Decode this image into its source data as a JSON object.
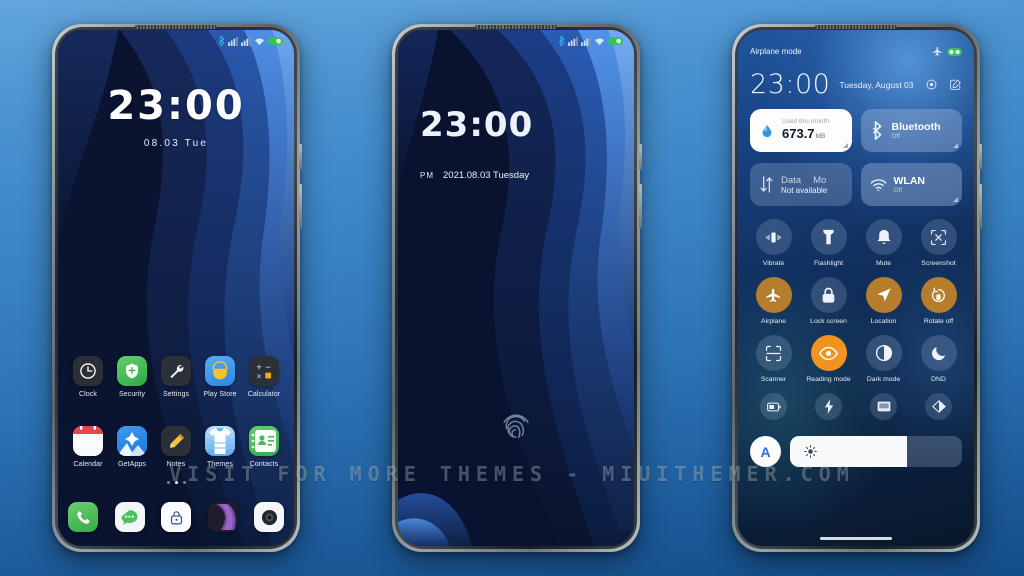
{
  "watermark": "VISIT FOR MORE THEMES - MIUITHEMER.COM",
  "theme": {
    "background_gradient_top": "#63a6dd",
    "background_gradient_bottom": "#144d88",
    "wallpaper_dark": "#0a1430",
    "wallpaper_blue": "#2f6fc4",
    "accent_orange": "#f0941f",
    "accent_gold": "#b57d2c"
  },
  "status_bar": {
    "icons": [
      "bluetooth-icon",
      "signal-sim1-icon",
      "signal-sim2-icon",
      "wifi-icon",
      "battery-icon"
    ]
  },
  "phone1": {
    "name": "home-screen",
    "clock": {
      "time": "23:00",
      "date": "08.03 Tue"
    },
    "apps_row1": [
      {
        "label": "Clock",
        "icon": "clock-icon"
      },
      {
        "label": "Security",
        "icon": "shield-icon"
      },
      {
        "label": "Settings",
        "icon": "wrench-icon"
      },
      {
        "label": "Play Store",
        "icon": "play-store-icon"
      },
      {
        "label": "Calculator",
        "icon": "calculator-icon"
      }
    ],
    "apps_row2": [
      {
        "label": "Calendar",
        "icon": "calendar-icon"
      },
      {
        "label": "GetApps",
        "icon": "getapps-icon"
      },
      {
        "label": "Notes",
        "icon": "pencil-icon"
      },
      {
        "label": "Themes",
        "icon": "themes-icon"
      },
      {
        "label": "Contacts",
        "icon": "contacts-icon"
      }
    ],
    "dock": [
      {
        "label": "Phone",
        "icon": "phone-icon"
      },
      {
        "label": "Messages",
        "icon": "message-icon"
      },
      {
        "label": "Security",
        "icon": "lock-icon"
      },
      {
        "label": "Browser",
        "icon": "browser-icon"
      },
      {
        "label": "Camera",
        "icon": "camera-icon"
      }
    ],
    "page_dots": 3,
    "active_dot": 2
  },
  "phone2": {
    "name": "lock-screen",
    "clock": {
      "time": "23:00",
      "ampm": "PM",
      "date": "2021.08.03 Tuesday"
    },
    "fingerprint": "fingerprint-icon"
  },
  "phone3": {
    "name": "control-center",
    "airplane_label": "Airplane mode",
    "top_icons": [
      "airplane-icon",
      "battery-icon"
    ],
    "clock": {
      "time": "23:00",
      "date": "Tuesday, August 03"
    },
    "actions": [
      "settings-gear-icon",
      "edit-icon"
    ],
    "big_tiles": [
      {
        "name": "data-usage",
        "icon": "data-drop-icon",
        "title": "Used this month",
        "value": "673.7",
        "unit": "MB",
        "style": "light"
      },
      {
        "name": "bluetooth",
        "icon": "bluetooth-icon",
        "title": "Bluetooth",
        "state": "Off",
        "style": "mid"
      },
      {
        "name": "mobile-data",
        "icon": "data-arrows-icon",
        "title_a": "Data",
        "title_b": "Mo",
        "state": "Not available",
        "style": "dim"
      },
      {
        "name": "wlan",
        "icon": "wifi-icon",
        "title": "WLAN",
        "state": "Off",
        "style": "mid"
      }
    ],
    "toggles_row1": [
      {
        "label": "Vibrate",
        "icon": "vibrate-icon",
        "active": false
      },
      {
        "label": "Flashlight",
        "icon": "flashlight-icon",
        "active": false
      },
      {
        "label": "Mute",
        "icon": "bell-icon",
        "active": false
      },
      {
        "label": "Screenshot",
        "icon": "screenshot-icon",
        "active": false
      }
    ],
    "toggles_row2": [
      {
        "label": "Airplane",
        "icon": "airplane-icon",
        "active": true
      },
      {
        "label": "Lock screen",
        "icon": "lock-icon",
        "active": false
      },
      {
        "label": "Location",
        "icon": "location-icon",
        "active": true
      },
      {
        "label": "Rotate off",
        "icon": "rotate-icon",
        "active": true
      }
    ],
    "toggles_row3": [
      {
        "label": "Scanner",
        "icon": "scan-icon",
        "active": false
      },
      {
        "label": "Reading mode",
        "icon": "eye-icon",
        "active": "orange"
      },
      {
        "label": "Dark mode",
        "icon": "contrast-icon",
        "active": false
      },
      {
        "label": "DND",
        "icon": "moon-icon",
        "active": false
      }
    ],
    "mini_row": [
      {
        "name": "battery-saver",
        "icon": "battery-saver-icon"
      },
      {
        "name": "quick-charge",
        "icon": "bolt-icon"
      },
      {
        "name": "cast",
        "icon": "cast-icon"
      },
      {
        "name": "theme",
        "icon": "theme-icon"
      }
    ],
    "brightness": {
      "auto_label": "A",
      "icon": "sun-icon",
      "level": 68
    }
  }
}
